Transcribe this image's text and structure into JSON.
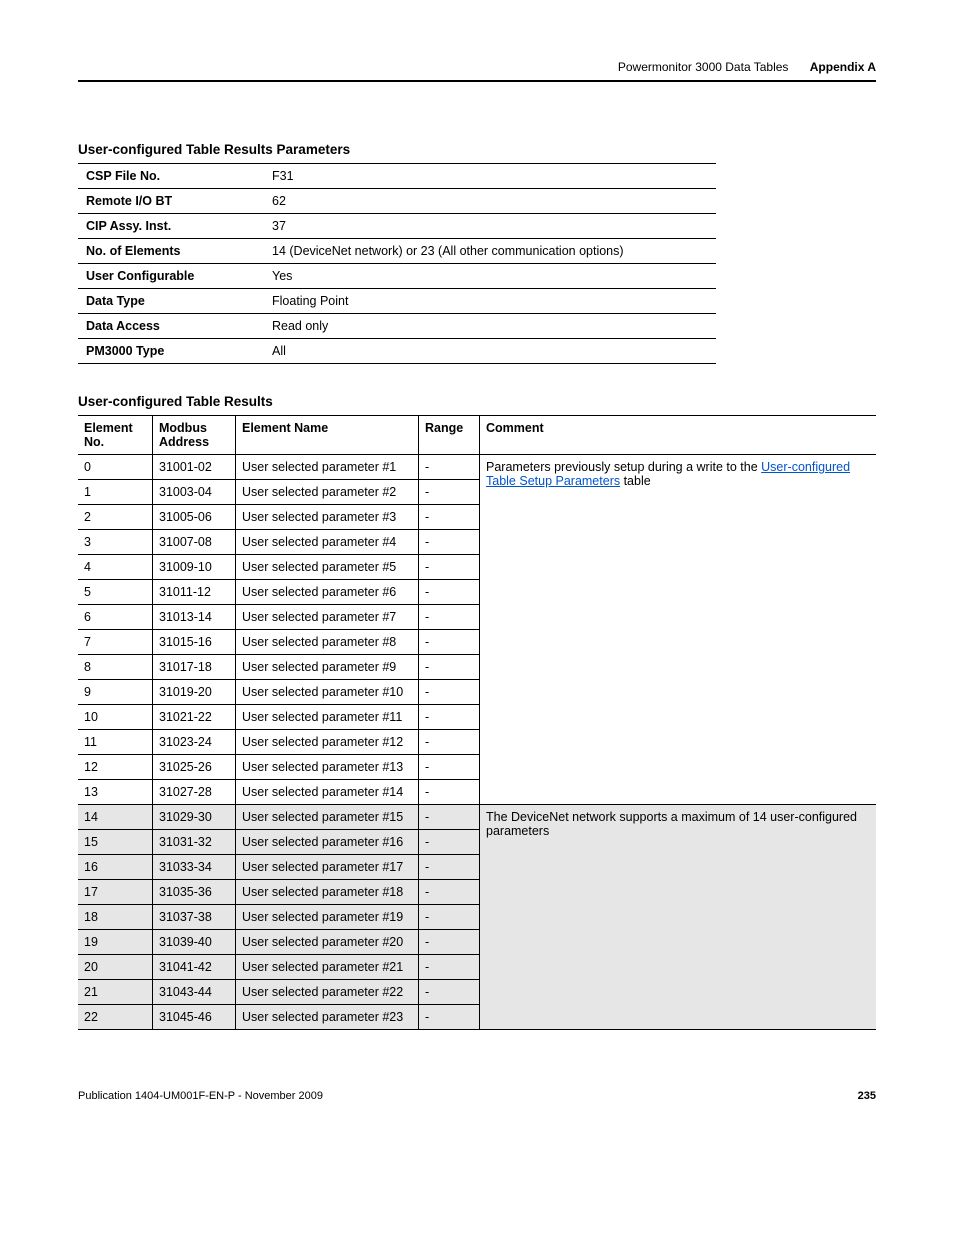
{
  "header": {
    "doc_section": "Powermonitor 3000 Data Tables",
    "appendix": "Appendix A"
  },
  "params_title": "User-configured Table Results Parameters",
  "params": [
    {
      "key": "CSP File No.",
      "value": "F31"
    },
    {
      "key": "Remote I/O BT",
      "value": "62"
    },
    {
      "key": "CIP Assy. Inst.",
      "value": "37"
    },
    {
      "key": "No. of Elements",
      "value": "14 (DeviceNet network) or 23 (All other communication options)"
    },
    {
      "key": "User Configurable",
      "value": "Yes"
    },
    {
      "key": "Data Type",
      "value": "Floating Point"
    },
    {
      "key": "Data Access",
      "value": "Read only"
    },
    {
      "key": "PM3000 Type",
      "value": "All"
    }
  ],
  "results_title": "User-configured Table Results",
  "results_headers": {
    "elno": "Element No.",
    "modbus": "Modbus Address",
    "ename": "Element Name",
    "range": "Range",
    "comment": "Comment"
  },
  "results_rows": [
    {
      "elno": "0",
      "modbus": "31001-02",
      "ename": "User selected parameter #1",
      "range": "-",
      "shaded": false
    },
    {
      "elno": "1",
      "modbus": "31003-04",
      "ename": "User selected parameter #2",
      "range": "-",
      "shaded": false
    },
    {
      "elno": "2",
      "modbus": "31005-06",
      "ename": "User selected parameter #3",
      "range": "-",
      "shaded": false
    },
    {
      "elno": "3",
      "modbus": "31007-08",
      "ename": "User selected parameter #4",
      "range": "-",
      "shaded": false
    },
    {
      "elno": "4",
      "modbus": "31009-10",
      "ename": "User selected parameter #5",
      "range": "-",
      "shaded": false
    },
    {
      "elno": "5",
      "modbus": "31011-12",
      "ename": "User selected parameter #6",
      "range": "-",
      "shaded": false
    },
    {
      "elno": "6",
      "modbus": "31013-14",
      "ename": "User selected parameter #7",
      "range": "-",
      "shaded": false
    },
    {
      "elno": "7",
      "modbus": "31015-16",
      "ename": "User selected parameter #8",
      "range": "-",
      "shaded": false
    },
    {
      "elno": "8",
      "modbus": "31017-18",
      "ename": "User selected parameter #9",
      "range": "-",
      "shaded": false
    },
    {
      "elno": "9",
      "modbus": "31019-20",
      "ename": "User selected parameter #10",
      "range": "-",
      "shaded": false
    },
    {
      "elno": "10",
      "modbus": "31021-22",
      "ename": "User selected parameter #11",
      "range": "-",
      "shaded": false
    },
    {
      "elno": "11",
      "modbus": "31023-24",
      "ename": "User selected parameter #12",
      "range": "-",
      "shaded": false
    },
    {
      "elno": "12",
      "modbus": "31025-26",
      "ename": "User selected parameter #13",
      "range": "-",
      "shaded": false
    },
    {
      "elno": "13",
      "modbus": "31027-28",
      "ename": "User selected parameter #14",
      "range": "-",
      "shaded": false
    },
    {
      "elno": "14",
      "modbus": "31029-30",
      "ename": "User selected parameter #15",
      "range": "-",
      "shaded": true
    },
    {
      "elno": "15",
      "modbus": "31031-32",
      "ename": "User selected parameter #16",
      "range": "-",
      "shaded": true
    },
    {
      "elno": "16",
      "modbus": "31033-34",
      "ename": "User selected parameter #17",
      "range": "-",
      "shaded": true
    },
    {
      "elno": "17",
      "modbus": "31035-36",
      "ename": "User selected parameter #18",
      "range": "-",
      "shaded": true
    },
    {
      "elno": "18",
      "modbus": "31037-38",
      "ename": "User selected parameter #19",
      "range": "-",
      "shaded": true
    },
    {
      "elno": "19",
      "modbus": "31039-40",
      "ename": "User selected parameter #20",
      "range": "-",
      "shaded": true
    },
    {
      "elno": "20",
      "modbus": "31041-42",
      "ename": "User selected parameter #21",
      "range": "-",
      "shaded": true
    },
    {
      "elno": "21",
      "modbus": "31043-44",
      "ename": "User selected parameter #22",
      "range": "-",
      "shaded": true
    },
    {
      "elno": "22",
      "modbus": "31045-46",
      "ename": "User selected parameter #23",
      "range": "-",
      "shaded": true
    }
  ],
  "comment_blocks": {
    "group1": {
      "start": 0,
      "span": 14,
      "prefix": "Parameters previously setup during a write to the ",
      "link": "User-configured Table Setup Parameters",
      "suffix": " table"
    },
    "group2": {
      "start": 14,
      "span": 9,
      "text": "The DeviceNet network supports a maximum of 14 user-configured parameters"
    }
  },
  "footer": {
    "pub": "Publication 1404-UM001F-EN-P - November 2009",
    "page": "235"
  }
}
